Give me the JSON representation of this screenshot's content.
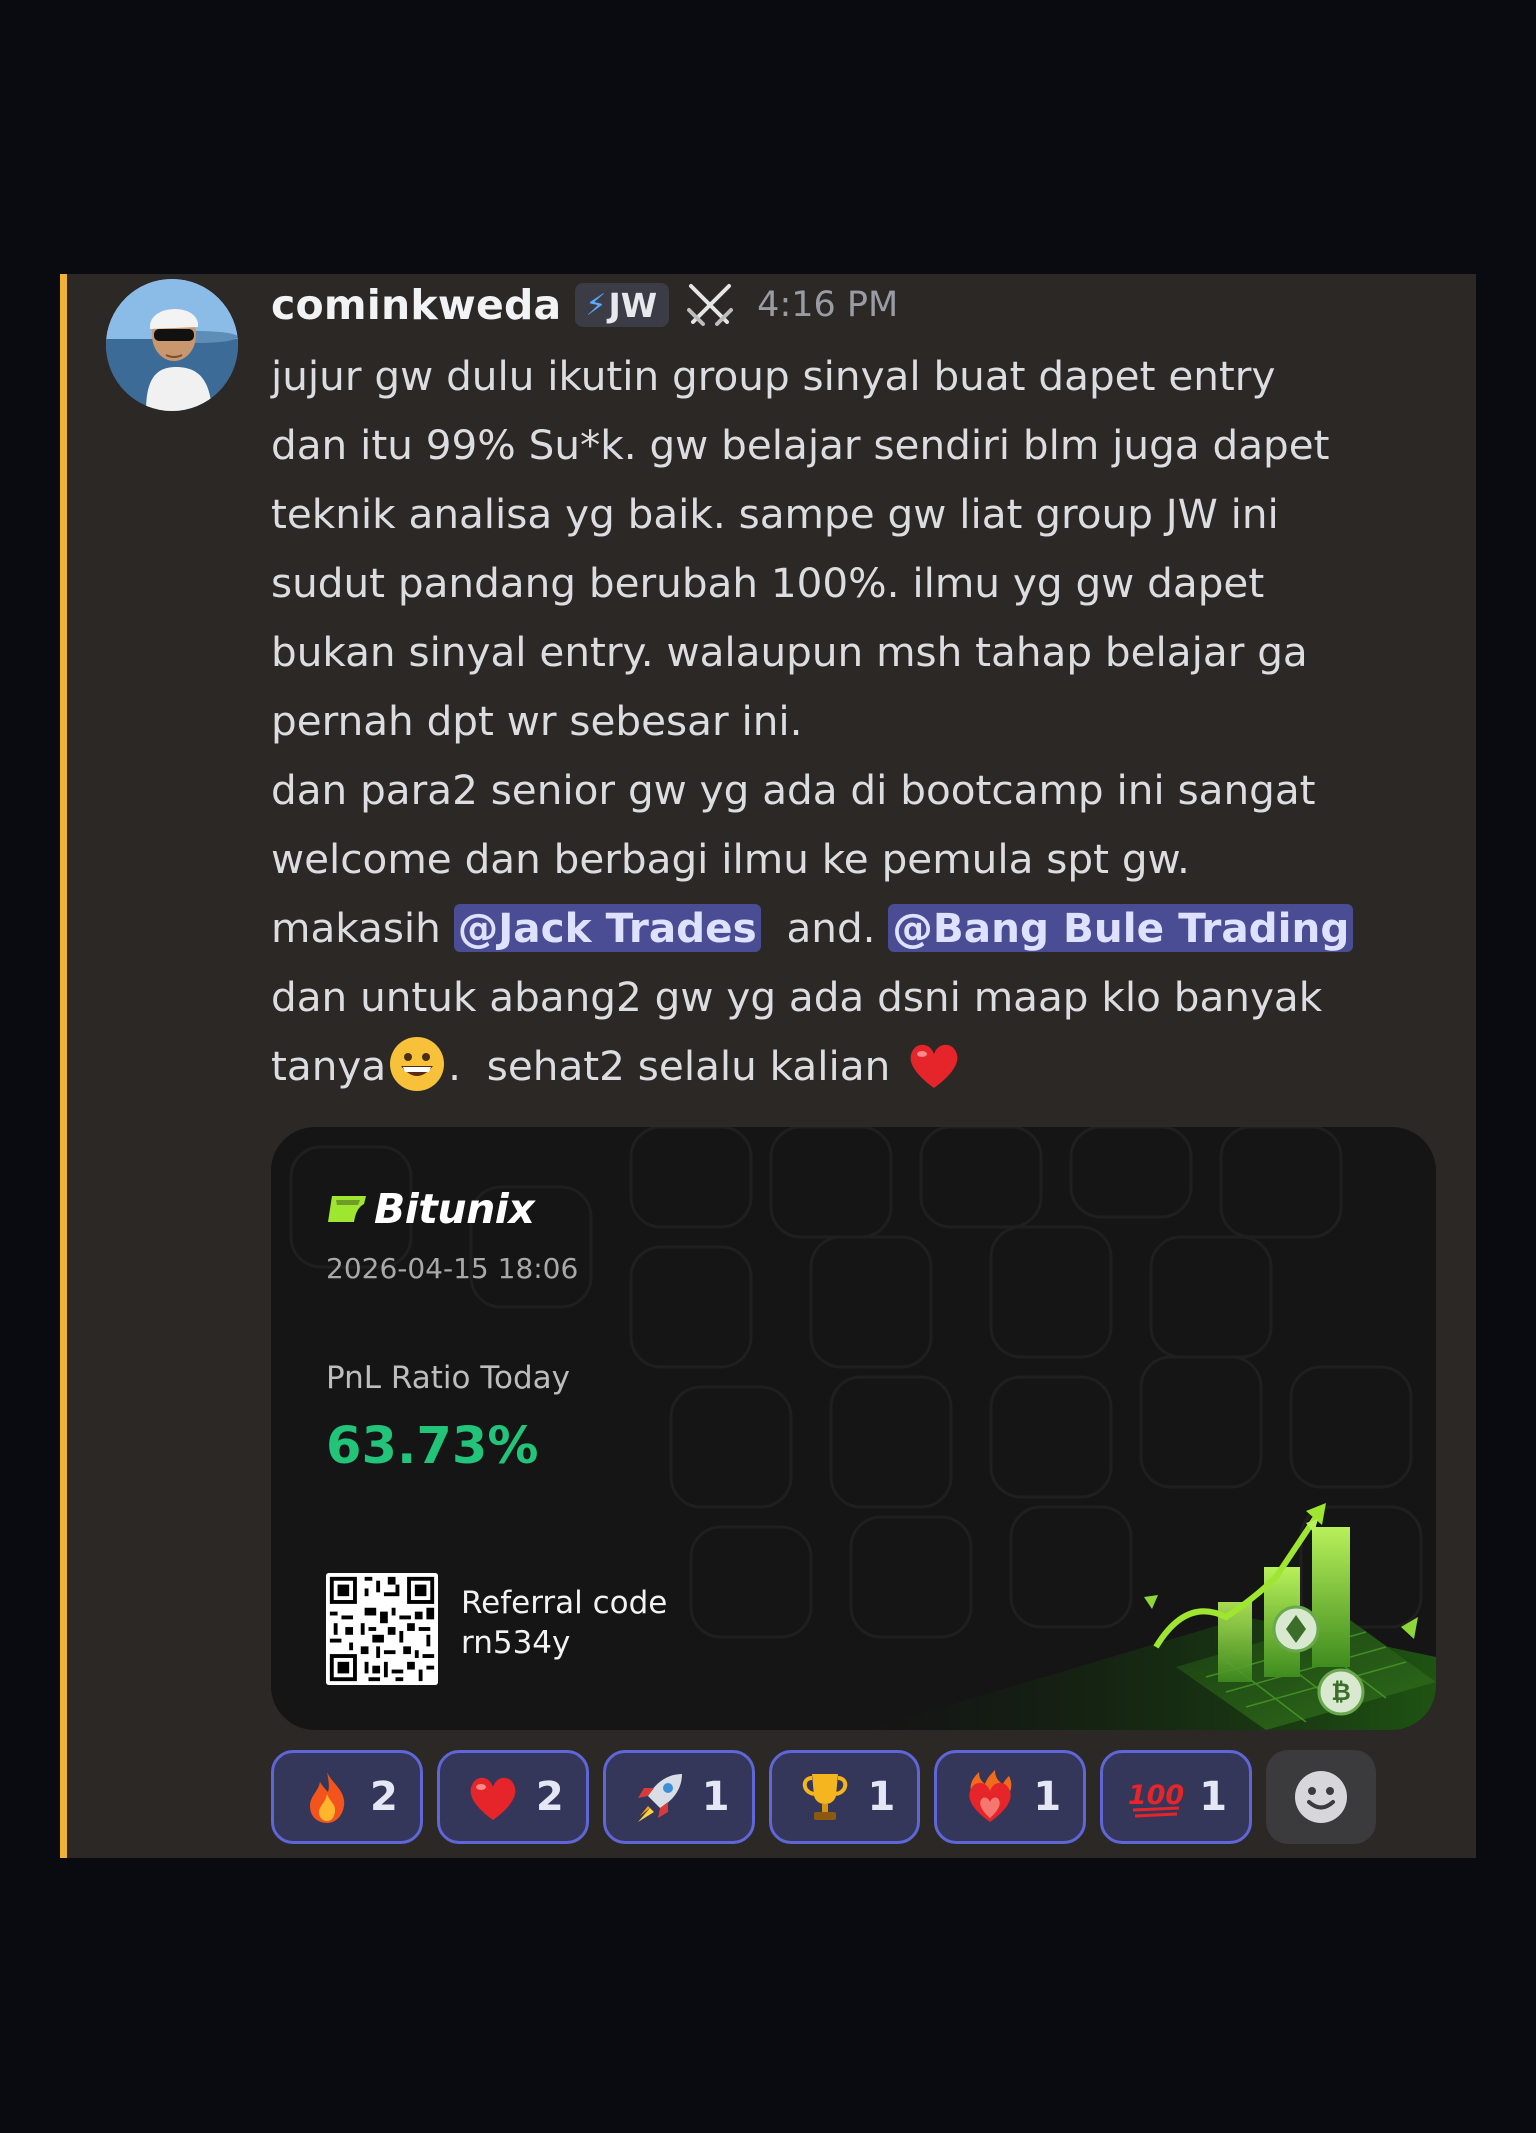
{
  "message": {
    "author": "cominkweda",
    "role_tag": "JW",
    "timestamp": "4:16 PM",
    "lines": [
      "jujur gw dulu ikutin group sinyal buat dapet entry",
      "dan itu 99% Su*k. gw belajar sendiri blm juga dapet",
      "teknik analisa yg baik. sampe gw liat group JW ini",
      "sudut pandang berubah 100%. ilmu yg gw dapet",
      "bukan sinyal entry. walaupun msh tahap belajar ga",
      "pernah dpt wr sebesar ini.",
      "dan para2 senior gw yg ada di bootcamp ini sangat",
      "welcome dan berbagi ilmu ke pemula spt gw."
    ],
    "thanks_prefix": "makasih ",
    "mention_1": "@Jack Trades",
    "thanks_middle": "  and. ",
    "mention_2": "@Bang Bule Trading",
    "line_after_mentions": "dan untuk abang2 gw yg ada dsni maap klo banyak",
    "last_line_start": "tanya",
    "last_line_end": ".  sehat2 selalu kalian "
  },
  "card": {
    "brand": "Bitunix",
    "date": "2026-04-15 18:06",
    "pnl_label": "PnL Ratio Today",
    "pnl_value": "63.73%",
    "referral_label": "Referral code",
    "referral_code": "rn534y",
    "accent_color": "#22c47a"
  },
  "reactions": [
    {
      "emoji": "fire-emoji",
      "count": "2"
    },
    {
      "emoji": "red-heart-emoji",
      "count": "2"
    },
    {
      "emoji": "rocket-emoji",
      "count": "1"
    },
    {
      "emoji": "trophy-emoji",
      "count": "1"
    },
    {
      "emoji": "heart-on-fire-emoji",
      "count": "1"
    },
    {
      "emoji": "hundred-points-emoji",
      "count": "1"
    }
  ],
  "colors": {
    "highlight_bar": "#f0b232",
    "message_bg": "#2b2826",
    "mention_bg": "#4a4d94",
    "reaction_border": "#5f66d6"
  }
}
